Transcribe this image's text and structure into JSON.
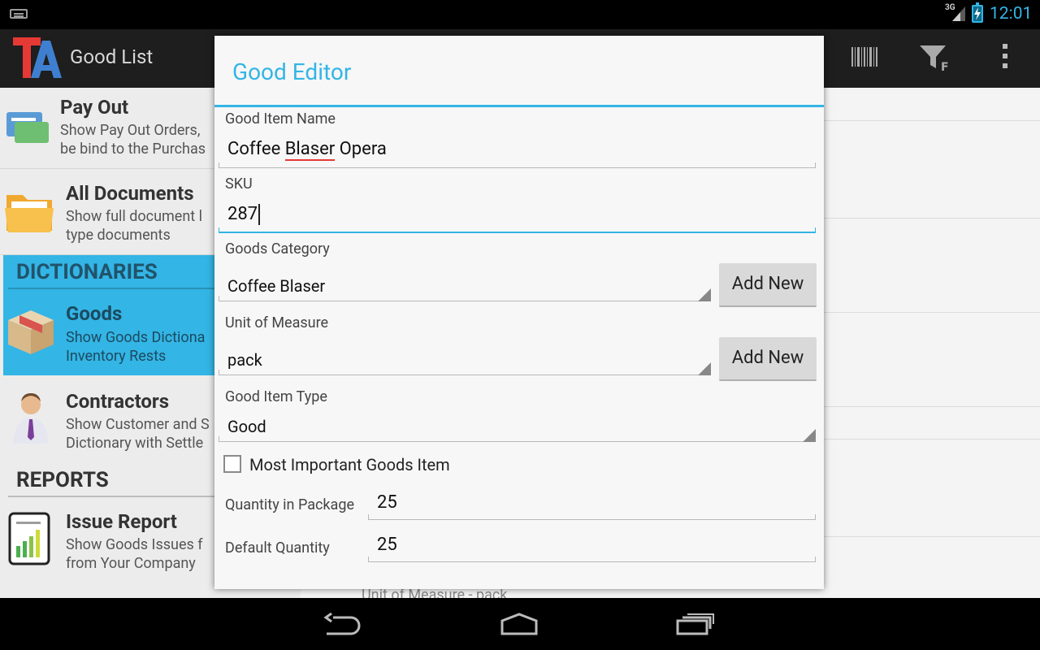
{
  "statusbar": {
    "network": "3G",
    "time": "12:01"
  },
  "actionbar": {
    "title": "Good List"
  },
  "nav": {
    "pay_out": {
      "title": "Pay Out",
      "desc1": "Show Pay Out Orders,",
      "desc2": "be bind to the Purchas"
    },
    "all_docs": {
      "title": "All Documents",
      "desc1": "Show full document l",
      "desc2": "type documents"
    },
    "dictionaries": "DICTIONARIES",
    "goods": {
      "title": "Goods",
      "desc1": "Show Goods Dictiona",
      "desc2": "Inventory Rests"
    },
    "contractors": {
      "title": "Contractors",
      "desc1": "Show Customer and S",
      "desc2": "Dictionary with Settle"
    },
    "reports": "REPORTS",
    "issue_report": {
      "title": "Issue Report",
      "desc1": "Show Goods Issues f",
      "desc2": "from Your Company"
    }
  },
  "right_panel": {
    "bottom_text": "Unit of Measure - pack"
  },
  "dialog": {
    "title": "Good Editor",
    "name_label": "Good Item Name",
    "name_value_part1": "Coffee ",
    "name_value_part2": "Blaser",
    "name_value_part3": " Opera",
    "sku_label": "SKU",
    "sku_value": "287",
    "category_label": "Goods Category",
    "category_value": "Coffee Blaser",
    "add_new_label": "Add New",
    "uom_label": "Unit of Measure",
    "uom_value": "pack",
    "type_label": "Good Item Type",
    "type_value": "Good",
    "important_label": "Most Important Goods Item",
    "qty_pkg_label": "Quantity in Package",
    "qty_pkg_value": "25",
    "default_qty_label": "Default Quantity",
    "default_qty_value": "25"
  },
  "colors": {
    "accent": "#33b5e5",
    "background_dark": "#000000",
    "dialog_bg": "#f7f7f7"
  }
}
